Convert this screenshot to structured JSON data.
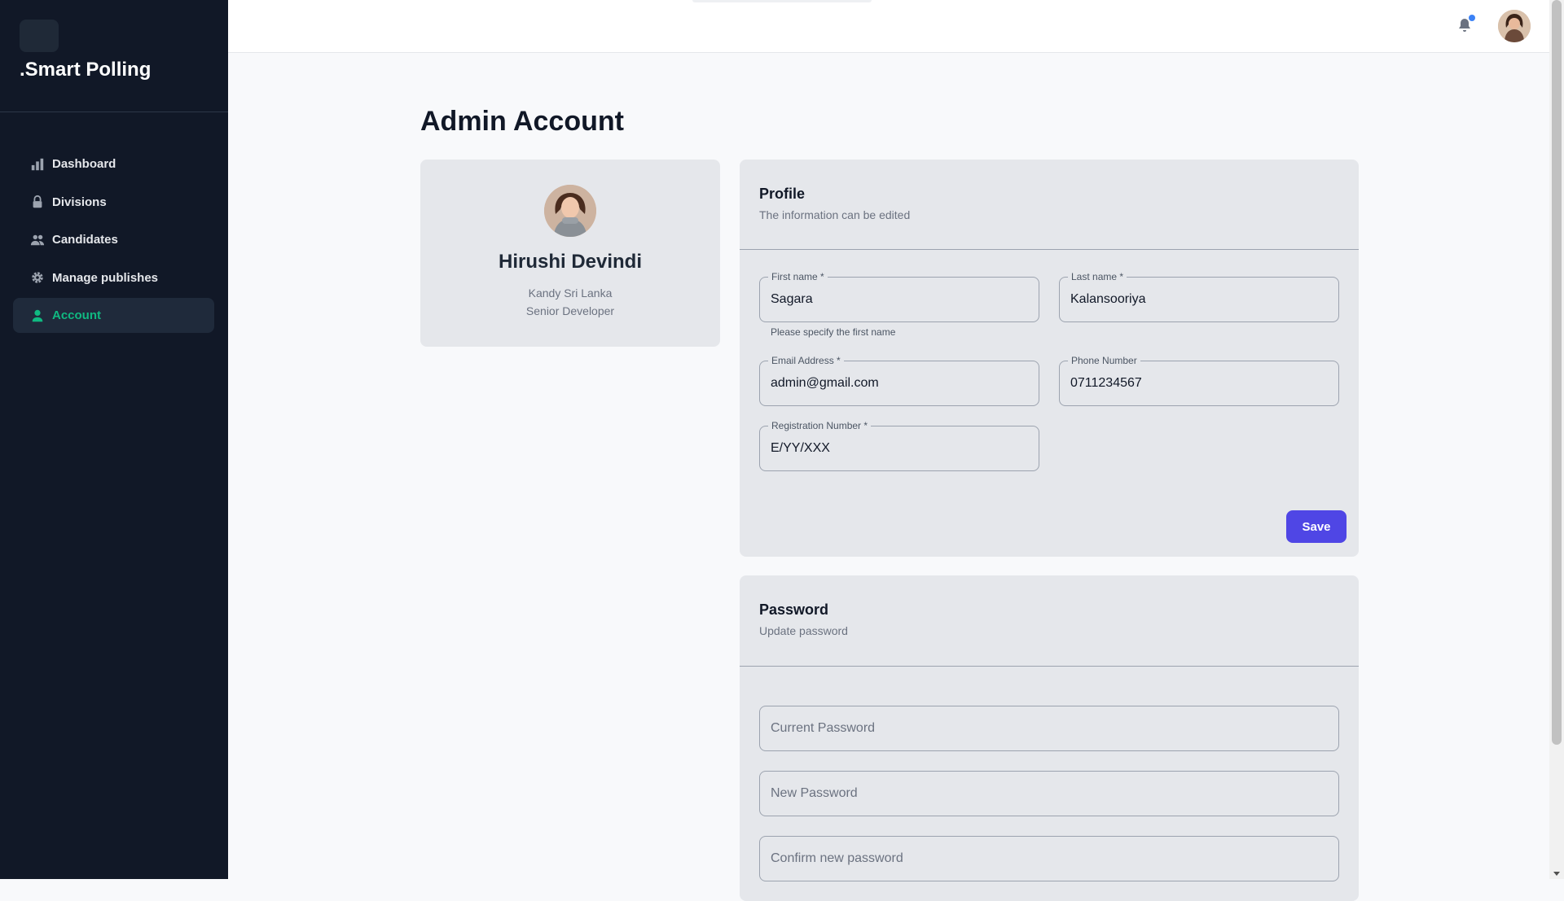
{
  "app": {
    "brand": ".Smart Polling"
  },
  "sidebar": {
    "items": [
      {
        "label": "Dashboard",
        "icon": "bar-chart-icon",
        "active": false
      },
      {
        "label": "Divisions",
        "icon": "lock-icon",
        "active": false
      },
      {
        "label": "Candidates",
        "icon": "users-icon",
        "active": false
      },
      {
        "label": "Manage publishes",
        "icon": "gear-icon",
        "active": false
      },
      {
        "label": "Account",
        "icon": "user-icon",
        "active": true
      }
    ],
    "active_color": "#10b981"
  },
  "header": {
    "notification_icon": "bell-icon",
    "has_notification": true
  },
  "page": {
    "title": "Admin Account"
  },
  "summary": {
    "name": "Hirushi Devindi",
    "location": "Kandy Sri Lanka",
    "role": "Senior Developer"
  },
  "profile": {
    "title": "Profile",
    "subtitle": "The information can be edited",
    "fields": {
      "first_name": {
        "label": "First name *",
        "value": "Sagara",
        "helper": "Please specify the first name"
      },
      "last_name": {
        "label": "Last name *",
        "value": "Kalansooriya"
      },
      "email": {
        "label": "Email Address *",
        "value": "admin@gmail.com"
      },
      "phone": {
        "label": "Phone Number",
        "value": "0711234567"
      },
      "registration": {
        "label": "Registration Number *",
        "value": "E/YY/XXX"
      }
    },
    "save_label": "Save",
    "accent_color": "#4f46e5"
  },
  "password": {
    "title": "Password",
    "subtitle": "Update password",
    "current_placeholder": "Current Password",
    "new_placeholder": "New Password",
    "confirm_placeholder": "Confirm new password"
  }
}
